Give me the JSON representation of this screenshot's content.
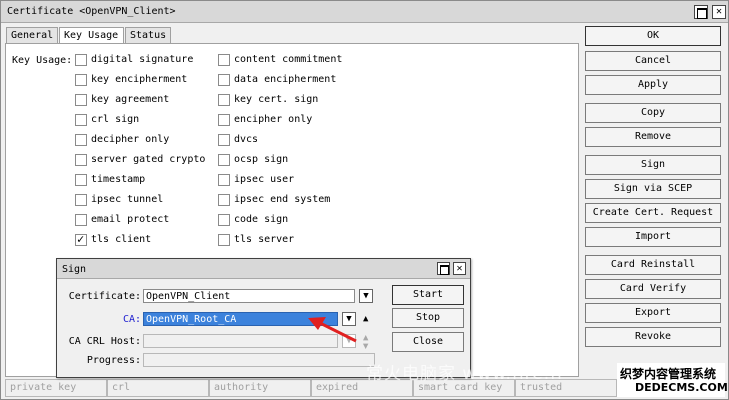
{
  "window": {
    "title": "Certificate <OpenVPN_Client>",
    "maximize_glyph": "",
    "close_glyph": "✕"
  },
  "tabs": [
    {
      "label": "General",
      "active": false
    },
    {
      "label": "Key Usage",
      "active": true
    },
    {
      "label": "Status",
      "active": false
    }
  ],
  "key_usage": {
    "label": "Key Usage:",
    "left_column": [
      {
        "label": "digital signature",
        "checked": false
      },
      {
        "label": "key encipherment",
        "checked": false
      },
      {
        "label": "key agreement",
        "checked": false
      },
      {
        "label": "crl sign",
        "checked": false
      },
      {
        "label": "decipher only",
        "checked": false
      },
      {
        "label": "server gated crypto",
        "checked": false
      },
      {
        "label": "timestamp",
        "checked": false
      },
      {
        "label": "ipsec tunnel",
        "checked": false
      },
      {
        "label": "email protect",
        "checked": false
      },
      {
        "label": "tls client",
        "checked": true
      }
    ],
    "right_column": [
      {
        "label": "content commitment",
        "checked": false
      },
      {
        "label": "data encipherment",
        "checked": false
      },
      {
        "label": "key cert. sign",
        "checked": false
      },
      {
        "label": "encipher only",
        "checked": false
      },
      {
        "label": "dvcs",
        "checked": false
      },
      {
        "label": "ocsp sign",
        "checked": false
      },
      {
        "label": "ipsec user",
        "checked": false
      },
      {
        "label": "ipsec end system",
        "checked": false
      },
      {
        "label": "code sign",
        "checked": false
      },
      {
        "label": "tls server",
        "checked": false
      }
    ]
  },
  "actions": [
    "OK",
    "Cancel",
    "Apply",
    "Copy",
    "Remove",
    "Sign",
    "Sign via SCEP",
    "Create Cert. Request",
    "Import",
    "Card Reinstall",
    "Card Verify",
    "Export",
    "Revoke"
  ],
  "statusbar": [
    "private key",
    "crl",
    "authority",
    "expired",
    "smart card key",
    "trusted"
  ],
  "sign_dialog": {
    "title": "Sign",
    "certificate_label": "Certificate:",
    "certificate_value": "OpenVPN_Client",
    "ca_label": "CA:",
    "ca_value": "OpenVPN_Root_CA",
    "ca_crl_host_label": "CA CRL Host:",
    "ca_crl_host_value": "",
    "progress_label": "Progress:",
    "progress_value": "",
    "start_label": "Start",
    "stop_label": "Stop",
    "close_label": "Close",
    "dropdown_glyph": "▼",
    "up_glyph": "▲"
  },
  "annotation": {
    "arrow_color": "#e02020"
  },
  "watermark": {
    "ghost_text": "常火电脑家 www.fire.fl",
    "line1": "织梦内容管理系统",
    "line2": "DEDECMS.COM"
  }
}
